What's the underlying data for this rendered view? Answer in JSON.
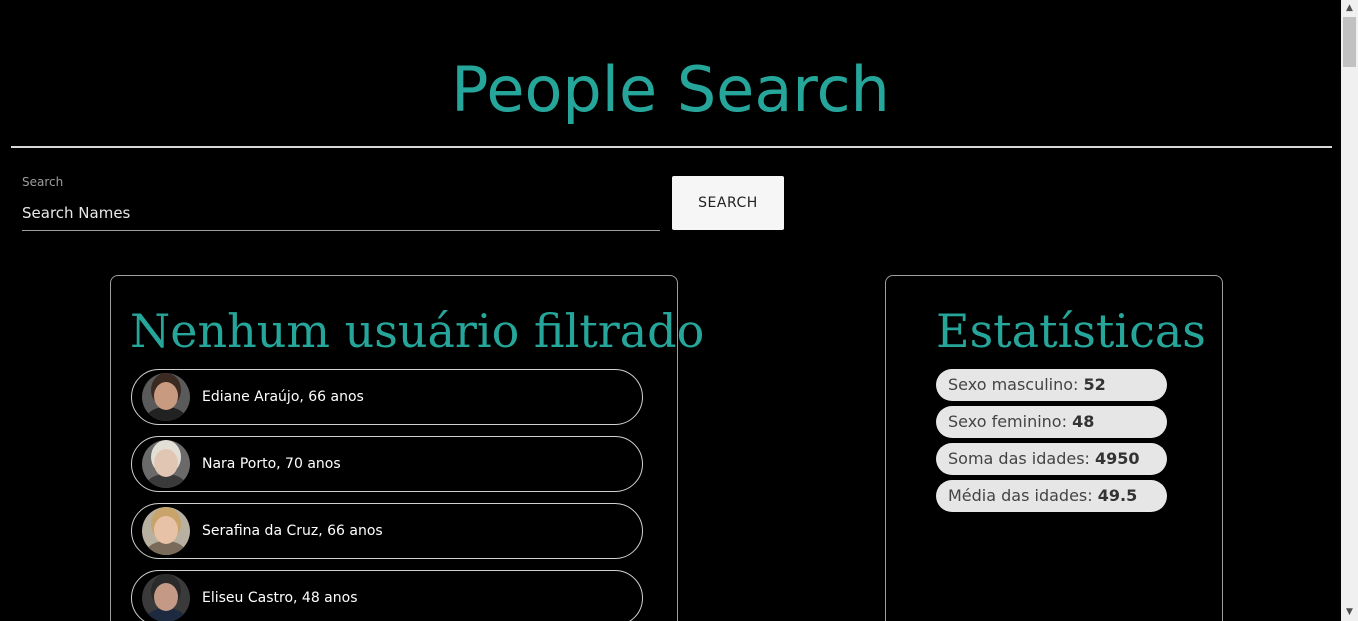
{
  "header": {
    "title": "People Search"
  },
  "search": {
    "label": "Search",
    "placeholder": "Search Names",
    "value": "",
    "button_label": "Search"
  },
  "users_panel": {
    "title": "Nenhum usuário filtrado",
    "users": [
      {
        "text": "Ediane Araújo, 66 anos",
        "avatar": {
          "hair": "#3a2a22",
          "skin": "#c89a80",
          "bg": "#5a5a5a",
          "clothes": "#222222"
        }
      },
      {
        "text": "Nara Porto, 70 anos",
        "avatar": {
          "hair": "#e2e0d6",
          "skin": "#e2c6b4",
          "bg": "#6a6a6a",
          "clothes": "#3a3a3a"
        }
      },
      {
        "text": "Serafina da Cruz, 66 anos",
        "avatar": {
          "hair": "#c8a46a",
          "skin": "#e8c2a6",
          "bg": "#b8b0a0",
          "clothes": "#7a6a5a"
        }
      },
      {
        "text": "Eliseu Castro, 48 anos",
        "avatar": {
          "hair": "#2a2a2a",
          "skin": "#c49a86",
          "bg": "#3a3a3a",
          "clothes": "#1e2a40"
        }
      }
    ]
  },
  "stats_panel": {
    "title": "Estatísticas",
    "stats": [
      {
        "label": "Sexo masculino:",
        "value": "52"
      },
      {
        "label": "Sexo feminino:",
        "value": "48"
      },
      {
        "label": "Soma das idades:",
        "value": "4950"
      },
      {
        "label": "Média das idades:",
        "value": "49.5"
      }
    ]
  },
  "colors": {
    "accent": "#26a69a",
    "background": "#000000",
    "pill": "#e6e6e6"
  }
}
